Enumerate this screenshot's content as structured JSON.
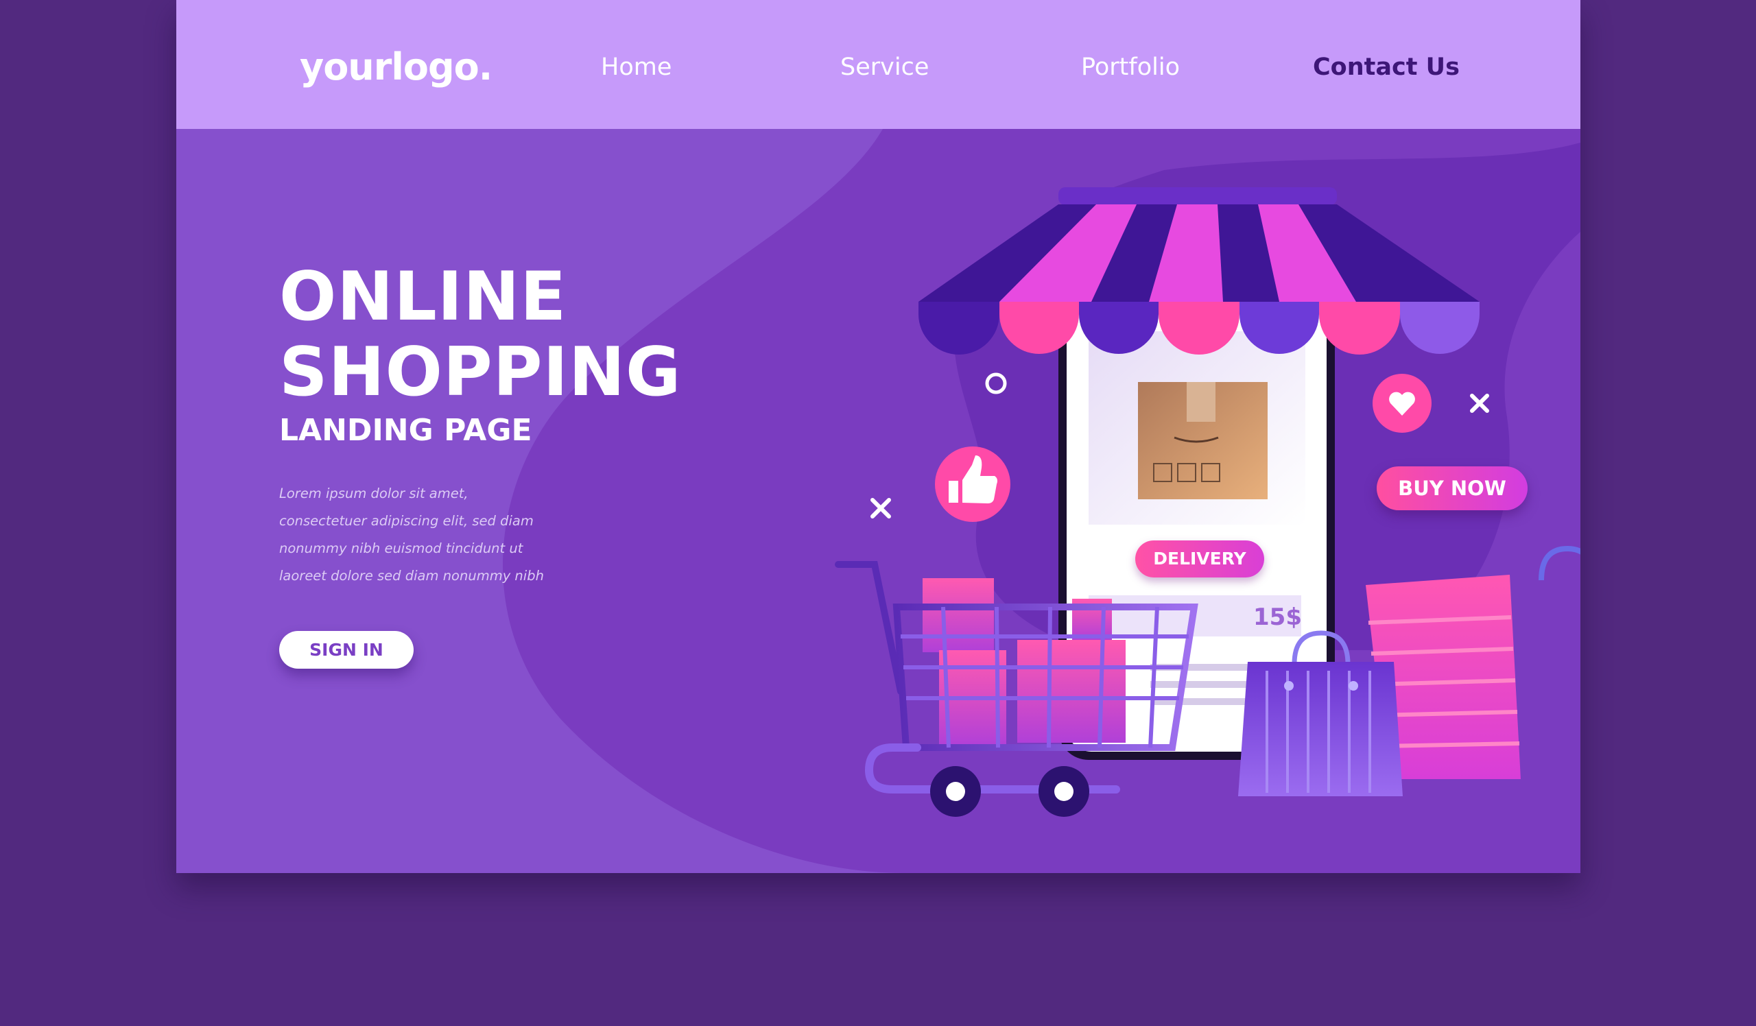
{
  "colors": {
    "outer_background": "#52297f",
    "navbar": "#c69afa",
    "hero": "#8650cd",
    "accent_pink": "#ff4fa0",
    "active_nav": "#3d1677"
  },
  "header": {
    "logo": "yourlogo.",
    "nav": [
      {
        "label": "Home",
        "active": false
      },
      {
        "label": "Service",
        "active": false
      },
      {
        "label": "Portfolio",
        "active": false
      },
      {
        "label": "Contact Us",
        "active": true
      }
    ]
  },
  "hero": {
    "title_line1": "ONLINE",
    "title_line2": "SHOPPING",
    "subtitle": "LANDING PAGE",
    "body_lines": [
      "Lorem ipsum dolor sit amet,",
      "consectetuer adipiscing elit, sed diam",
      "nonummy nibh euismod tincidunt ut",
      "laoreet dolore sed diam nonummy nibh"
    ],
    "sign_in_label": "SIGN IN"
  },
  "illustration": {
    "buy_now_label": "BUY NOW",
    "delivery_label": "DELIVERY",
    "price": "15$",
    "icons": [
      "storefront-awning-icon",
      "phone-icon",
      "package-box-icon",
      "thumbs-up-icon",
      "heart-icon",
      "shopping-cart-icon",
      "shopping-bag-icon",
      "close-x-icon",
      "circle-ring-icon"
    ]
  }
}
